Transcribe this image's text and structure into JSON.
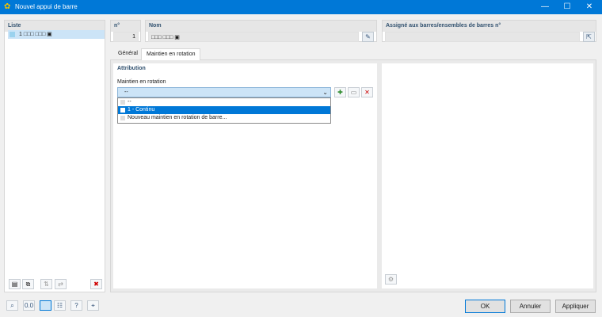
{
  "window": {
    "title": "Nouvel appui de barre",
    "minimize": "—",
    "maximize": "☐",
    "close": "✕"
  },
  "list": {
    "header": "Liste",
    "items": [
      {
        "number": "1",
        "name": "□□□ □□□ ▣"
      }
    ]
  },
  "number": {
    "header": "n°",
    "value": "1"
  },
  "name": {
    "header": "Nom",
    "value": "□□□ □□□ ▣"
  },
  "assigned": {
    "header": "Assigné aux barres/ensembles de barres n°",
    "value": ""
  },
  "tabs": [
    {
      "label": "Général"
    },
    {
      "label": "Maintien en rotation"
    }
  ],
  "attribution": {
    "title": "Attribution",
    "label": "Maintien en rotation",
    "selected": "--",
    "options": [
      "--",
      "1 - Continu",
      "Nouveau maintien en rotation de barre..."
    ]
  },
  "buttons": {
    "ok": "OK",
    "cancel": "Annuler",
    "apply": "Appliquer"
  },
  "icons": {
    "edit": "✎",
    "delete": "✖",
    "arrow": "⌄"
  }
}
